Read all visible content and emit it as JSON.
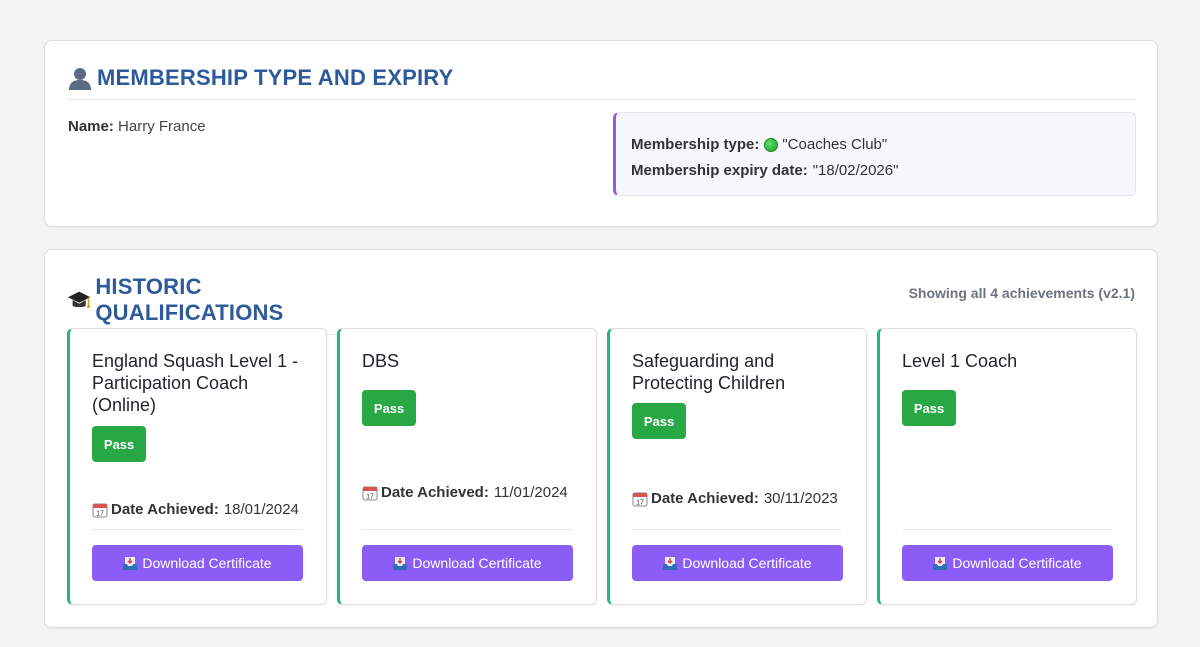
{
  "membership": {
    "title": "MEMBERSHIP TYPE AND EXPIRY",
    "name_label": "Name:",
    "name_value": "Harry France",
    "type_label": "Membership type:",
    "type_value": "\"Coaches Club\"",
    "expiry_label": "Membership expiry date:",
    "expiry_value": "\"18/02/2026\""
  },
  "qualifications": {
    "title": "HISTORIC QUALIFICATIONS",
    "count_text": "Showing all 4 achievements (v2.1)",
    "date_label": "Date Achieved:",
    "download_label": "Download Certificate",
    "cards": [
      {
        "title": "England Squash Level 1 - Participation Coach (Online)",
        "status": "Pass",
        "date": "18/01/2024"
      },
      {
        "title": "DBS",
        "status": "Pass",
        "date": "11/01/2024"
      },
      {
        "title": "Safeguarding and Protecting Children",
        "status": "Pass",
        "date": "30/11/2023"
      },
      {
        "title": "Level 1 Coach",
        "status": "Pass",
        "date": ""
      }
    ]
  },
  "colors": {
    "heading": "#2d5a9a",
    "pass": "#28a745",
    "button": "#8b5cf6",
    "card_accent": "#1fb87c",
    "membership_accent": "#8e5fd9"
  },
  "icons": {
    "membership": "person-icon",
    "qualifications": "graduation-cap-icon",
    "date": "calendar-icon",
    "download": "inbox-tray-icon",
    "type_status": "green-circle-icon"
  }
}
